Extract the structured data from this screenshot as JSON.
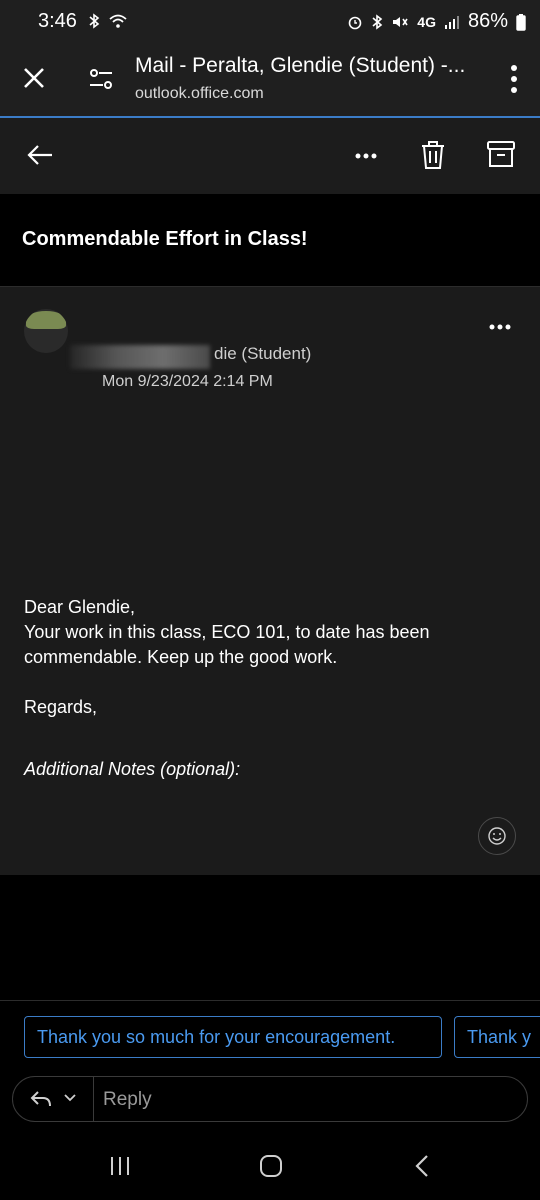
{
  "status": {
    "time": "3:46",
    "battery": "86%",
    "network": "4G"
  },
  "browser": {
    "title": "Mail - Peralta, Glendie (Student) -...",
    "url": "outlook.office.com"
  },
  "message": {
    "subject": "Commendable Effort in Class!",
    "sender_visible": "die (Student)",
    "date": "Mon 9/23/2024 2:14 PM",
    "body": {
      "greeting": "Dear  Glendie,",
      "line1": "Your work in this class, ECO 101, to date has been",
      "line2": "commendable.  Keep up the good work.",
      "closing": "Regards,"
    },
    "notes": "Additional Notes (optional):"
  },
  "suggestions": [
    "Thank you so much for your encouragement.",
    "Thank y"
  ],
  "reply": {
    "placeholder": "Reply"
  },
  "colors": {
    "accent": "#3b7cc7",
    "link": "#4a9af0",
    "background": "#000000"
  }
}
